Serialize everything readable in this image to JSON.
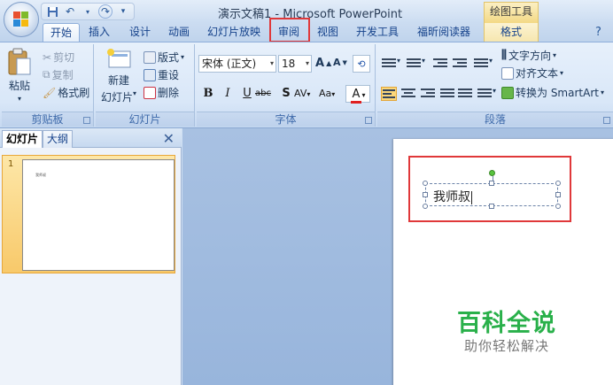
{
  "window": {
    "title": "演示文稿1 - Microsoft PowerPoint",
    "contextual_tools_label": "绘图工具"
  },
  "quick_access": {
    "save_icon": "save-icon",
    "undo_icon": "undo-icon",
    "redo_icon": "redo-icon"
  },
  "tabs": [
    {
      "label": "开始",
      "active": true
    },
    {
      "label": "插入"
    },
    {
      "label": "设计"
    },
    {
      "label": "动画"
    },
    {
      "label": "幻灯片放映"
    },
    {
      "label": "审阅",
      "highlighted": true
    },
    {
      "label": "视图"
    },
    {
      "label": "开发工具"
    },
    {
      "label": "福昕阅读器"
    },
    {
      "label": "格式",
      "contextual": true
    }
  ],
  "ribbon": {
    "clipboard": {
      "label": "剪贴板",
      "paste": "粘贴",
      "cut": "剪切",
      "copy": "复制",
      "format_painter": "格式刷"
    },
    "slides": {
      "label": "幻灯片",
      "new_slide_line1": "新建",
      "new_slide_line2": "幻灯片",
      "layout": "版式",
      "reset": "重设",
      "delete": "删除"
    },
    "font": {
      "label": "字体",
      "font_name": "宋体 (正文)",
      "font_size": "18",
      "grow": "A",
      "shrink": "A",
      "bold": "B",
      "italic": "I",
      "underline": "U",
      "strike": "abc",
      "shadow": "S",
      "spacing": "AV",
      "case": "Aa",
      "color": "A",
      "color_underline": "#e02020"
    },
    "paragraph": {
      "label": "段落",
      "text_direction": "文字方向",
      "align_text": "对齐文本",
      "convert_smartart": "转换为 SmartArt"
    }
  },
  "left_pane": {
    "tab_slides": "幻灯片",
    "tab_outline": "大纲",
    "slide_number": "1",
    "thumb_text": "我师叔"
  },
  "slide": {
    "textbox_text": "我师叔"
  },
  "watermark": {
    "line1": "百科全说",
    "line2": "助你轻松解决"
  },
  "colors": {
    "highlight": "#e0383a",
    "selected_thumb": "#f8c96a",
    "watermark_green": "#29b04a"
  }
}
